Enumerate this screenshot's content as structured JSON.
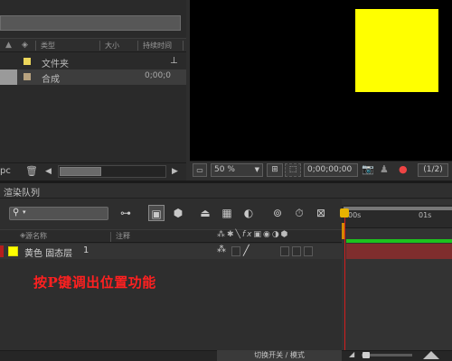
{
  "project_panel": {
    "columns": [
      "类型",
      "大小",
      "持续时间"
    ],
    "items": [
      {
        "name": "文件夹",
        "swatch": "#ecd65b",
        "duration": ""
      },
      {
        "name": "合成",
        "swatch": "#b9a37f",
        "duration": "0;00;0"
      }
    ],
    "footer_label": "pc"
  },
  "viewer": {
    "zoom": "50 %",
    "timecode": "0;00;00;00",
    "resolution": "(1/2)",
    "solid_color": "#ffff00"
  },
  "render_queue": {
    "tab_label": "渲染队列"
  },
  "timeline": {
    "columns": {
      "source_name": "源名称",
      "comment": "注释"
    },
    "layer": {
      "name": "黄色 固态层",
      "number": "1",
      "color": "#ffff00"
    },
    "ruler": {
      "t0": "00s",
      "t1": "01s"
    },
    "toggle_modes": "切换开关 / 模式"
  },
  "annotation": {
    "text": "按P键调出位置功能"
  }
}
